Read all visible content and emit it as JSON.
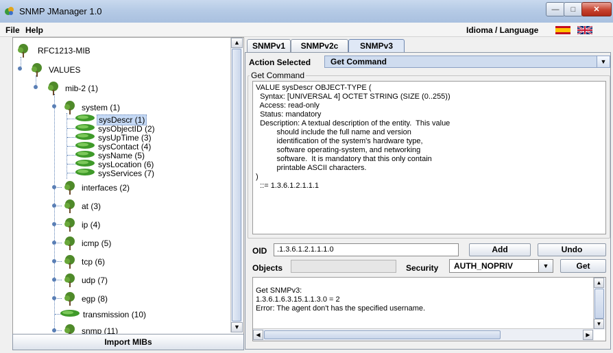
{
  "window": {
    "title": "SNMP JManager 1.0"
  },
  "menu": {
    "file": "File",
    "help": "Help",
    "language_label": "Idioma / Language"
  },
  "tree": {
    "root": "RFC1213-MIB",
    "values": "VALUES",
    "mib2": "mib-2 (1)",
    "system": "system (1)",
    "system_leaves": [
      "sysDescr (1)",
      "sysObjectID (2)",
      "sysUpTime (3)",
      "sysContact (4)",
      "sysName (5)",
      "sysLocation (6)",
      "sysServices (7)"
    ],
    "groups": [
      "interfaces (2)",
      "at (3)",
      "ip (4)",
      "icmp (5)",
      "tcp (6)",
      "udp (7)",
      "egp (8)",
      "transmission (10)",
      "snmp (11)"
    ],
    "selected": "sysDescr (1)"
  },
  "import_button": "Import MIBs",
  "tabs": [
    "SNMPv1",
    "SNMPv2c",
    "SNMPv3"
  ],
  "active_tab": "SNMPv3",
  "action": {
    "label": "Action Selected",
    "value": "Get Command"
  },
  "get_command": {
    "legend": "Get Command",
    "description": "VALUE sysDescr OBJECT-TYPE (\n  Syntax: [UNIVERSAL 4] OCTET STRING (SIZE (0..255))\n  Access: read-only\n  Status: mandatory\n  Description: A textual description of the entity.  This value\n          should include the full name and version\n          identification of the system's hardware type,\n          software operating-system, and networking\n          software.  It is mandatory that this only contain\n          printable ASCII characters.\n)\n  ::= 1.3.6.1.2.1.1.1"
  },
  "oid": {
    "label": "OID",
    "value": ".1.3.6.1.2.1.1.1.0"
  },
  "buttons": {
    "add": "Add",
    "undo": "Undo",
    "get": "Get"
  },
  "objects": {
    "label": "Objects",
    "value": ""
  },
  "security": {
    "label": "Security",
    "value": "AUTH_NOPRIV"
  },
  "output": "Get SNMPv3:\n1.3.6.1.6.3.15.1.1.3.0 = 2\nError: The agent don't has the specified username.",
  "colors": {
    "title_bar": "#b6cbe6",
    "selection": "#c5d9f5",
    "action_bg": "#cfdcef",
    "close_button": "#c7432f"
  },
  "icons": {
    "tree_node": "tree-icon",
    "leaf": "leaf-icon",
    "app": "app-icon"
  }
}
